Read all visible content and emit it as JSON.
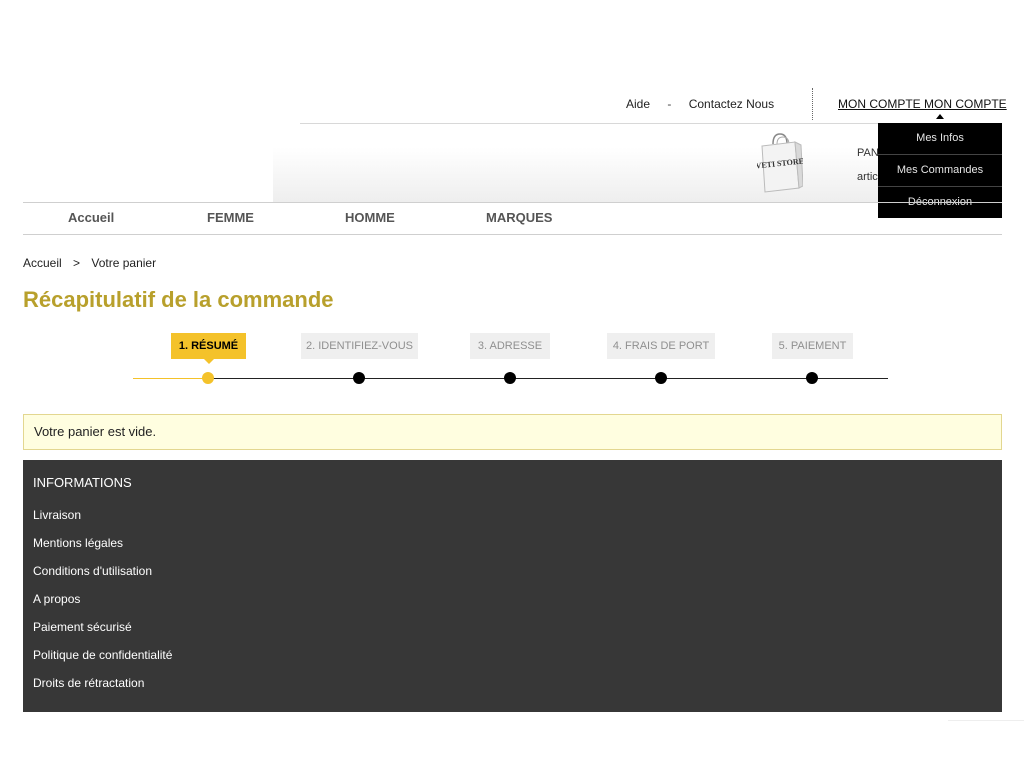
{
  "top_links": {
    "help": "Aide",
    "separator": "-",
    "contact": "Contactez Nous"
  },
  "account": {
    "label": "MON COMPTE MON COMPTE",
    "menu": [
      "Mes Infos",
      "Mes Commandes",
      "Déconnexion"
    ]
  },
  "cart": {
    "logo_text": "VETI STORE",
    "line1": "PAN",
    "line2": "artic"
  },
  "nav": [
    "Accueil",
    "FEMME",
    "HOMME",
    "MARQUES"
  ],
  "breadcrumb": {
    "home": "Accueil",
    "separator": ">",
    "current": "Votre panier"
  },
  "page_title": "Récapitulatif de la commande",
  "steps": [
    {
      "label": "1. RÉSUMÉ",
      "active": true
    },
    {
      "label": "2. IDENTIFIEZ-VOUS",
      "active": false
    },
    {
      "label": "3. ADRESSE",
      "active": false
    },
    {
      "label": "4. FRAIS DE PORT",
      "active": false
    },
    {
      "label": "5. PAIEMENT",
      "active": false
    }
  ],
  "empty_cart_message": "Votre panier est vide.",
  "footer": {
    "heading": "INFORMATIONS",
    "links": [
      "Livraison",
      "Mentions légales",
      "Conditions d'utilisation",
      "A propos",
      "Paiement sécurisé",
      "Politique de confidentialité",
      "Droits de rétractation"
    ]
  },
  "colors": {
    "accent_gold": "#b8a02c",
    "step_active": "#f4c22a",
    "footer_bg": "#373737",
    "notice_bg": "#fffee0"
  }
}
